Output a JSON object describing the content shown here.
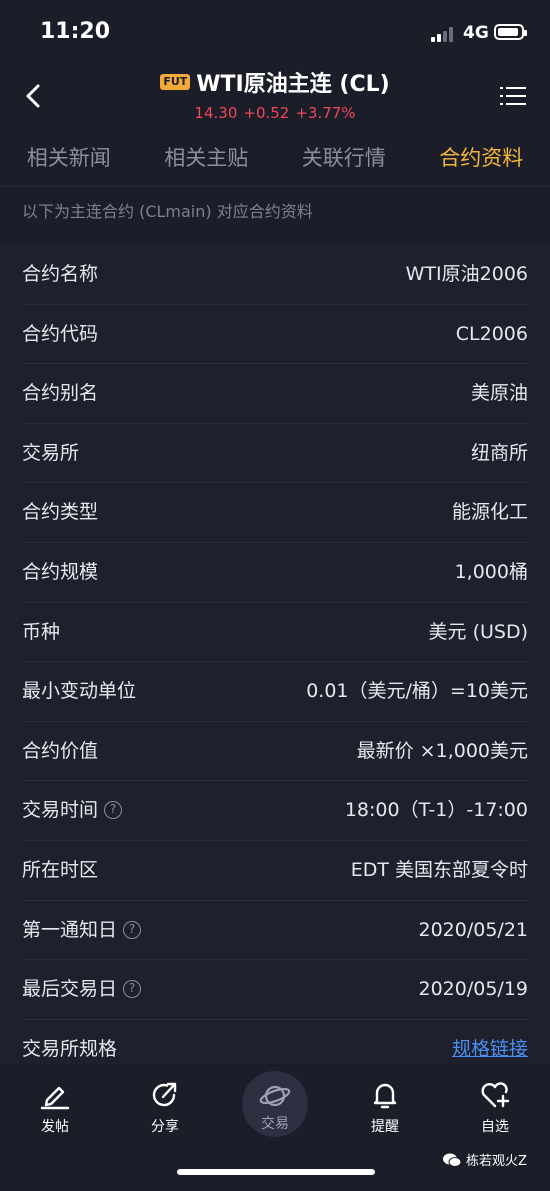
{
  "status_bar": {
    "time": "11:20",
    "network": "4G"
  },
  "header": {
    "badge": "FUT",
    "title": "WTI原油主连 (CL)",
    "price": "14.30",
    "change": "+0.52",
    "change_pct": "+3.77%"
  },
  "tabs": [
    {
      "label": "相关新闻"
    },
    {
      "label": "相关主贴"
    },
    {
      "label": "关联行情"
    },
    {
      "label": "合约资料",
      "active": true
    }
  ],
  "subtitle": "以下为主连合约 (CLmain) 对应合约资料",
  "rows": [
    {
      "label": "合约名称",
      "value": "WTI原油2006"
    },
    {
      "label": "合约代码",
      "value": "CL2006"
    },
    {
      "label": "合约别名",
      "value": "美原油"
    },
    {
      "label": "交易所",
      "value": "纽商所"
    },
    {
      "label": "合约类型",
      "value": "能源化工"
    },
    {
      "label": "合约规模",
      "value": "1,000桶"
    },
    {
      "label": "币种",
      "value": "美元 (USD)"
    },
    {
      "label": "最小变动单位",
      "value": "0.01（美元/桶）=10美元"
    },
    {
      "label": "合约价值",
      "value": "最新价 ×1,000美元"
    },
    {
      "label": "交易时间",
      "value": "18:00（T-1）-17:00",
      "help": "?"
    },
    {
      "label": "所在时区",
      "value": "EDT 美国东部夏令时"
    },
    {
      "label": "第一通知日",
      "value": "2020/05/21",
      "help": "?"
    },
    {
      "label": "最后交易日",
      "value": "2020/05/19",
      "help": "?"
    },
    {
      "label": "交易所规格",
      "value": "规格链接",
      "link": true
    }
  ],
  "bottom_nav": {
    "post": "发帖",
    "share": "分享",
    "trade": "交易",
    "alert": "提醒",
    "watchlist": "自选"
  },
  "watermark": "栋若观火Z",
  "colors": {
    "accent": "#f5b73d",
    "up": "#f0465a",
    "link": "#4a8ff0",
    "background": "#1b1d29"
  }
}
